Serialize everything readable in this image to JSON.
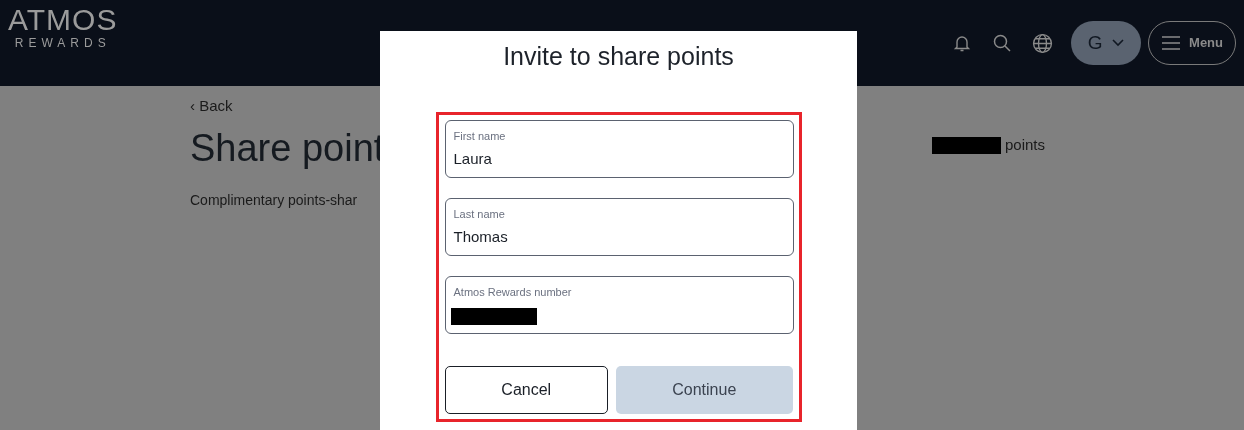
{
  "header": {
    "logo": {
      "wordmark": "ATMOS",
      "subtitle": "REWARDS"
    },
    "avatar_initial": "G",
    "menu_label": "Menu"
  },
  "page": {
    "back_link": "‹ Back",
    "title": "Share point",
    "intro": "Complimentary points-shar",
    "points_suffix": "points"
  },
  "dialog": {
    "title": "Invite to share points",
    "fields": [
      {
        "label": "First name",
        "value": "Laura"
      },
      {
        "label": "Last name",
        "value": "Thomas"
      },
      {
        "label": "Atmos Rewards number"
      }
    ],
    "buttons": [
      {
        "label": "Cancel",
        "kind": "secondary",
        "disabled": false
      },
      {
        "label": "Continue",
        "kind": "primary",
        "disabled": true
      }
    ]
  }
}
